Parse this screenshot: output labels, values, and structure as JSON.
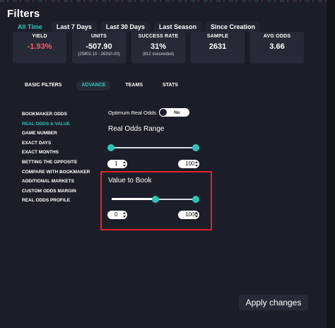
{
  "header": {
    "title": "Filters"
  },
  "time_tabs": [
    {
      "label": "All Time",
      "active": true
    },
    {
      "label": "Last 7 Days",
      "active": false
    },
    {
      "label": "Last 30 Days",
      "active": false
    },
    {
      "label": "Last Season",
      "active": false
    },
    {
      "label": "Since Creation",
      "active": false
    }
  ],
  "stats": [
    {
      "label": "YIELD",
      "value": "-1.93%",
      "sub": ""
    },
    {
      "label": "UNITS",
      "value": "-507.90",
      "sub": "(25802.10 - 26310.00)"
    },
    {
      "label": "SUCCESS RATE",
      "value": "31%",
      "sub": "(812 succeeded)"
    },
    {
      "label": "SAMPLE",
      "value": "2631",
      "sub": ""
    },
    {
      "label": "AVG ODDS",
      "value": "3.66",
      "sub": ""
    }
  ],
  "filter_tabs": [
    {
      "label": "BASIC FILTERS",
      "active": false
    },
    {
      "label": "ADVANCE",
      "active": true
    },
    {
      "label": "TEAMS",
      "active": false
    },
    {
      "label": "STATS",
      "active": false
    }
  ],
  "sidebar": {
    "items": [
      {
        "label": "BOOKMAKER ODDS",
        "active": false
      },
      {
        "label": "REAL ODDS & VALUE",
        "active": true
      },
      {
        "label": "GAME NUMBER",
        "active": false
      },
      {
        "label": "EXACT DAYS",
        "active": false
      },
      {
        "label": "EXACT MONTHS",
        "active": false
      },
      {
        "label": "BETTING THE OPPOSITE",
        "active": false
      },
      {
        "label": "COMPARE WITH BOOKMAKER",
        "active": false
      },
      {
        "label": "ADDITIONAL MARKETS",
        "active": false
      },
      {
        "label": "CUSTOM ODDS MARGIN",
        "active": false
      },
      {
        "label": "REAL ODDS PROFILE",
        "active": false
      }
    ]
  },
  "optimum": {
    "label": "Optimum Real Odds",
    "state": "No"
  },
  "real_odds_range": {
    "title": "Real Odds Range",
    "min": "1",
    "max": "100"
  },
  "value_to_book": {
    "title": "Value to Book",
    "min": "0",
    "max": "1000"
  },
  "colors": {
    "accent": "#2ec4b6",
    "negative": "#ff5a6a",
    "highlight": "#e0242e",
    "background": "#1b1e28"
  },
  "apply_button": {
    "label": "Apply changes"
  }
}
